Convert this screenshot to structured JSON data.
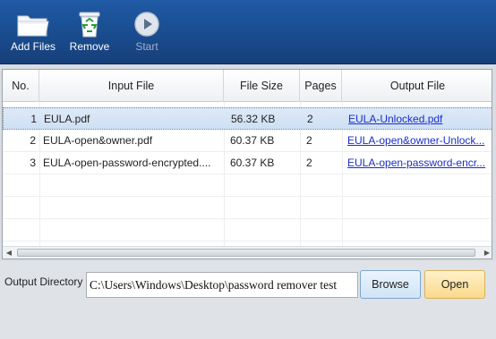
{
  "toolbar": {
    "add_files_label": "Add Files",
    "remove_label": "Remove",
    "start_label": "Start"
  },
  "table": {
    "columns": [
      "No.",
      "Input File",
      "File Size",
      "Pages",
      "Output File"
    ],
    "rows": [
      {
        "no": "1",
        "input": "EULA.pdf",
        "size": "56.32 KB",
        "pages": "2",
        "output": "EULA-Unlocked.pdf"
      },
      {
        "no": "2",
        "input": "EULA-open&owner.pdf",
        "size": "60.37 KB",
        "pages": "2",
        "output": "EULA-open&owner-Unlock..."
      },
      {
        "no": "3",
        "input": "EULA-open-password-encrypted....",
        "size": "60.37 KB",
        "pages": "2",
        "output": "EULA-open-password-encr..."
      }
    ],
    "selected_row": 1
  },
  "output": {
    "label": "Output Directory",
    "path": "C:\\Users\\Windows\\Desktop\\password remover test",
    "browse_label": "Browse",
    "open_label": "Open"
  },
  "icons": {
    "add_files": "folder-icon",
    "remove": "recycle-bin-icon",
    "start": "play-icon"
  },
  "colors": {
    "toolbar_bg": "#1a4f93",
    "link": "#1a2fc7",
    "open_button": "#fbd98c",
    "browse_button": "#cfe4f7"
  }
}
